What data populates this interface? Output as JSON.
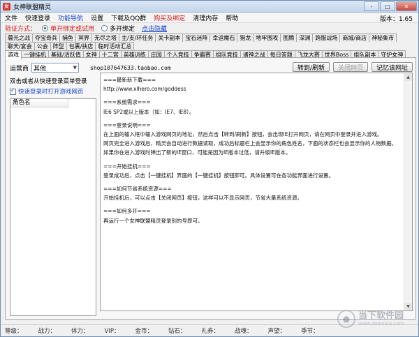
{
  "window": {
    "title": "女神联盟精灵",
    "icon_letter": "女",
    "controls": [
      "-",
      "□",
      "✕"
    ]
  },
  "menu": {
    "items": [
      {
        "label": "文件",
        "style": "normal"
      },
      {
        "label": "快速登录",
        "style": "normal"
      },
      {
        "label": "功能导航",
        "style": "blue"
      },
      {
        "label": "设置",
        "style": "normal"
      },
      {
        "label": "下载及QQ群",
        "style": "normal"
      },
      {
        "label": "购买及绑定",
        "style": "red"
      },
      {
        "label": "清理内存",
        "style": "normal"
      },
      {
        "label": "帮助",
        "style": "normal"
      }
    ],
    "version": "版本：1.65"
  },
  "verify": {
    "label": "验证方式：",
    "option1": "单开绑定或试用",
    "option2": "多开绑定",
    "hide_link": "点击隐藏"
  },
  "tabs": {
    "row1": [
      "暮光之战",
      "夺宝奇兵",
      "捕鱼",
      "冥界",
      "无尽之塔",
      "主/支/环任务",
      "关卡副本",
      "宝石迷阵",
      "幸运魔石",
      "猎龙",
      "地牢围攻",
      "图腾",
      "深渊",
      "跨服战场",
      "商城/商店",
      "神秘集市"
    ],
    "row2": [
      "聊天/宴会",
      "公会",
      "阵型",
      "包裹/扶店",
      "临时活动汇总"
    ],
    "row3": [
      "游戏",
      "一键挂机",
      "基础/活跃值",
      "女神",
      "十二宫",
      "英雄训练",
      "庄园",
      "个人竞技",
      "争霸赛",
      "组队竞技",
      "诸神之战",
      "每日答题",
      "飞龙大赛",
      "世界Boss",
      "组队副本",
      "守护女神"
    ],
    "active": "游戏"
  },
  "toolbar": {
    "operator_label": "运营商",
    "operator_value": "其他",
    "url": "shop107647633.taobao.com",
    "goto_button": "转到/刷新",
    "close_button": "关闭网页",
    "remember_button": "记忆该网址"
  },
  "left": {
    "hint": "双击或者从快速登录菜单登录",
    "checkbox_label": "快速登录时打开游戏网页",
    "list_header": "角色名"
  },
  "content": {
    "latest_title": "===最新新下载===",
    "latest_url": "http://www.xlhero.com/goddess",
    "req_title": "===系统需求===",
    "req_text": "IE6 SP2或以上版本（如：IE7、IE8）。",
    "login_title": "===登录说明===",
    "login_1": "在上面的输入框中输入游戏网页的地址，然后点击【转到/刷新】按钮，会出现IE打开网页，请在网页中登录并进入游戏。",
    "login_2": "网页完全进入游戏后，精灵会自动进行数据读取，成功后标题栏上会显示你的角色姓名，下面的状态栏也会显示你的人物数据。",
    "login_3": "如果你在进入游戏时弹出了新的IE窗口，可能是因为IE版本过低，请升级IE版本。",
    "hang_title": "===开始挂机===",
    "hang_text": "登录成功后，点击【一键挂机】界面的【一键挂机】按钮即可。具体设置可在各功能界面进行设置。",
    "save_title": "===如何节省系统资源===",
    "save_text": "开始挂机后，可以点击【关闭网页】按钮，这样可以不显示网页，节省大量系统资源。",
    "multi_title": "===如何多开===",
    "multi_text": "再运行一个女神联盟精灵登录别的号即可。"
  },
  "status": {
    "items": [
      "等级：",
      "战力：",
      "体力：",
      "VIP：",
      "金币：",
      "钻石：",
      "礼券：",
      "战魂：",
      "声望：",
      "季节："
    ]
  },
  "watermark": {
    "main": "当下软件园",
    "sub": "www.downxia.com"
  }
}
